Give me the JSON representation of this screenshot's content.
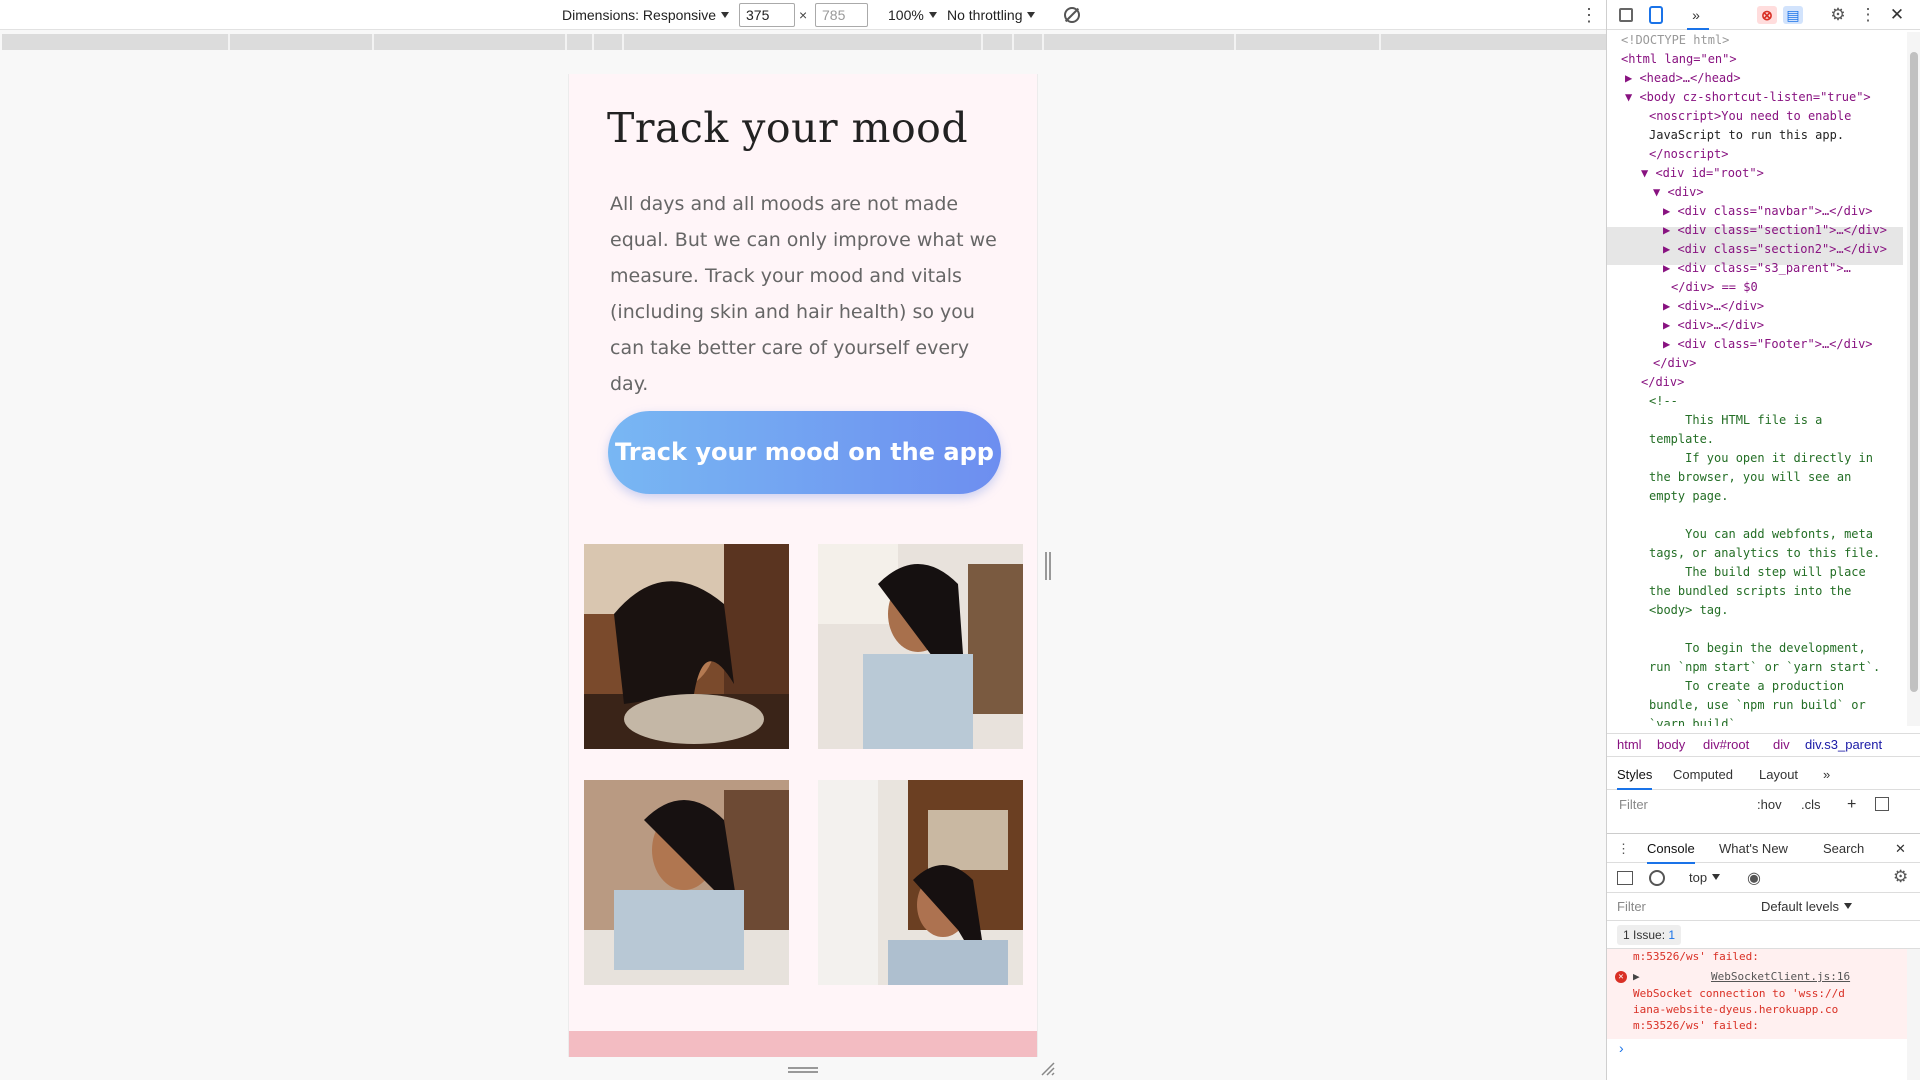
{
  "device_toolbar": {
    "dimensions_label": "Dimensions: Responsive",
    "width_value": "375",
    "height_value": "785",
    "times": "×",
    "zoom": "100%",
    "throttling": "No throttling",
    "more": "⋮"
  },
  "page": {
    "title": "Track your mood",
    "body_text": "All days and all moods are not made equal. But we can only improve what we measure. Track your mood and vitals (including skin and hair health) so you can take better care of yourself every day.",
    "cta_label": "Track your mood on the app"
  },
  "devtools": {
    "top_icons": {
      "chevron": "»",
      "gear": "⚙",
      "kebab": "⋮",
      "close": "✕",
      "err": "⊗",
      "msg": "▤"
    },
    "dom_lines": [
      {
        "t": "<!DOCTYPE html>",
        "c": "grey"
      },
      {
        "t": "<html lang=\"en\">",
        "c": "tag"
      },
      {
        "t": "▶ <head>…</head>",
        "c": "tag"
      },
      {
        "t": "▼ <body cz-shortcut-listen=\"true\">",
        "c": "tag"
      },
      {
        "t": "<noscript>You need to enable",
        "c": "tag"
      },
      {
        "t": "JavaScript to run this app.",
        "c": "txt"
      },
      {
        "t": "</noscript>",
        "c": "tag"
      },
      {
        "t": "▼ <div id=\"root\">",
        "c": "tag"
      },
      {
        "t": "▼ <div>",
        "c": "tag"
      },
      {
        "t": "▶ <div class=\"navbar\">…</div>",
        "c": "tag"
      },
      {
        "t": "▶ <div class=\"section1\">…</div>",
        "c": "tag"
      },
      {
        "t": "▶ <div class=\"section2\">…</div>",
        "c": "tag"
      },
      {
        "t": "▶ <div class=\"s3_parent\">…",
        "c": "tag"
      },
      {
        "t": "</div> == $0",
        "c": "tag"
      },
      {
        "t": "▶ <div>…</div>",
        "c": "tag"
      },
      {
        "t": "▶ <div>…</div>",
        "c": "tag"
      },
      {
        "t": "▶ <div class=\"Footer\">…</div>",
        "c": "tag"
      },
      {
        "t": "</div>",
        "c": "tag"
      },
      {
        "t": "</div>",
        "c": "tag"
      },
      {
        "t": "<!--",
        "c": "cmt"
      },
      {
        "t": "     This HTML file is a",
        "c": "cmt"
      },
      {
        "t": "template.",
        "c": "cmt"
      },
      {
        "t": "     If you open it directly in",
        "c": "cmt"
      },
      {
        "t": "the browser, you will see an",
        "c": "cmt"
      },
      {
        "t": "empty page.",
        "c": "cmt"
      },
      {
        "t": "",
        "c": "cmt"
      },
      {
        "t": "     You can add webfonts, meta",
        "c": "cmt"
      },
      {
        "t": "tags, or analytics to this file.",
        "c": "cmt"
      },
      {
        "t": "     The build step will place",
        "c": "cmt"
      },
      {
        "t": "the bundled scripts into the",
        "c": "cmt"
      },
      {
        "t": "<body> tag.",
        "c": "cmt"
      },
      {
        "t": "",
        "c": "cmt"
      },
      {
        "t": "     To begin the development,",
        "c": "cmt"
      },
      {
        "t": "run `npm start` or `yarn start`.",
        "c": "cmt"
      },
      {
        "t": "     To create a production",
        "c": "cmt"
      },
      {
        "t": "bundle, use `npm run build` or",
        "c": "cmt"
      },
      {
        "t": "`yarn build`.",
        "c": "cmt"
      }
    ],
    "breadcrumbs": [
      "html",
      "body",
      "div#root",
      "div",
      "div.s3_parent"
    ],
    "styles_tabs": [
      "Styles",
      "Computed",
      "Layout",
      "»"
    ],
    "styles_filter_placeholder": "Filter",
    "hov": ":hov",
    "cls": ".cls",
    "drawer_tabs": [
      "Console",
      "What's New",
      "Search"
    ],
    "context": "top",
    "console_filter_placeholder": "Filter",
    "levels": "Default levels",
    "issues": "1 Issue:",
    "issues_count": "1",
    "log_top": "m:53526/ws' failed:",
    "log_source": "WebSocketClient.js:16",
    "log_lines": [
      "WebSocket connection to 'wss://d",
      "iana-website-dyeus.herokuapp.co",
      "m:53526/ws' failed:"
    ],
    "prompt": "›"
  }
}
